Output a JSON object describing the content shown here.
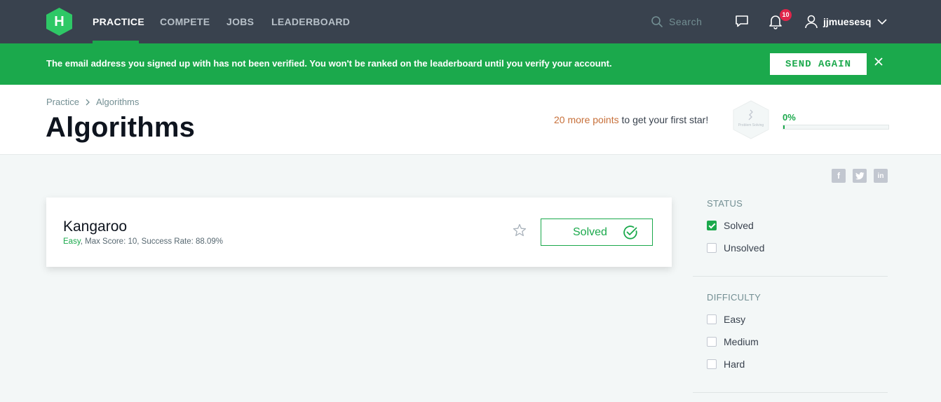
{
  "nav": {
    "logo_letter": "H",
    "links": [
      "PRACTICE",
      "COMPETE",
      "JOBS",
      "LEADERBOARD"
    ],
    "search_placeholder": "Search",
    "notification_count": "10",
    "username": "jjmuesesq"
  },
  "banner": {
    "message": "The email address you signed up with has not been verified. You won't be ranked on the leaderboard until you verify your account.",
    "button_label": "SEND AGAIN"
  },
  "header": {
    "breadcrumb": [
      "Practice",
      "Algorithms"
    ],
    "title": "Algorithms",
    "points_highlight": "20 more points",
    "points_rest": " to get your first star!",
    "badge_label": "Problem Solving",
    "progress_text": "0%",
    "progress_fraction": 0.01
  },
  "social": [
    "f",
    "t",
    "in"
  ],
  "challenge": {
    "name": "Kangaroo",
    "difficulty": "Easy",
    "meta_rest": ", Max Score: 10, Success Rate: 88.09%",
    "button_label": "Solved"
  },
  "filters": {
    "status": {
      "heading": "STATUS",
      "options": [
        {
          "label": "Solved",
          "checked": true
        },
        {
          "label": "Unsolved",
          "checked": false
        }
      ]
    },
    "difficulty": {
      "heading": "DIFFICULTY",
      "options": [
        {
          "label": "Easy",
          "checked": false
        },
        {
          "label": "Medium",
          "checked": false
        },
        {
          "label": "Hard",
          "checked": false
        }
      ]
    }
  },
  "colors": {
    "brand_green": "#1ba94c",
    "nav_bg": "#39424e",
    "notification_red": "#e0254a",
    "points_orange": "#c7703a"
  }
}
